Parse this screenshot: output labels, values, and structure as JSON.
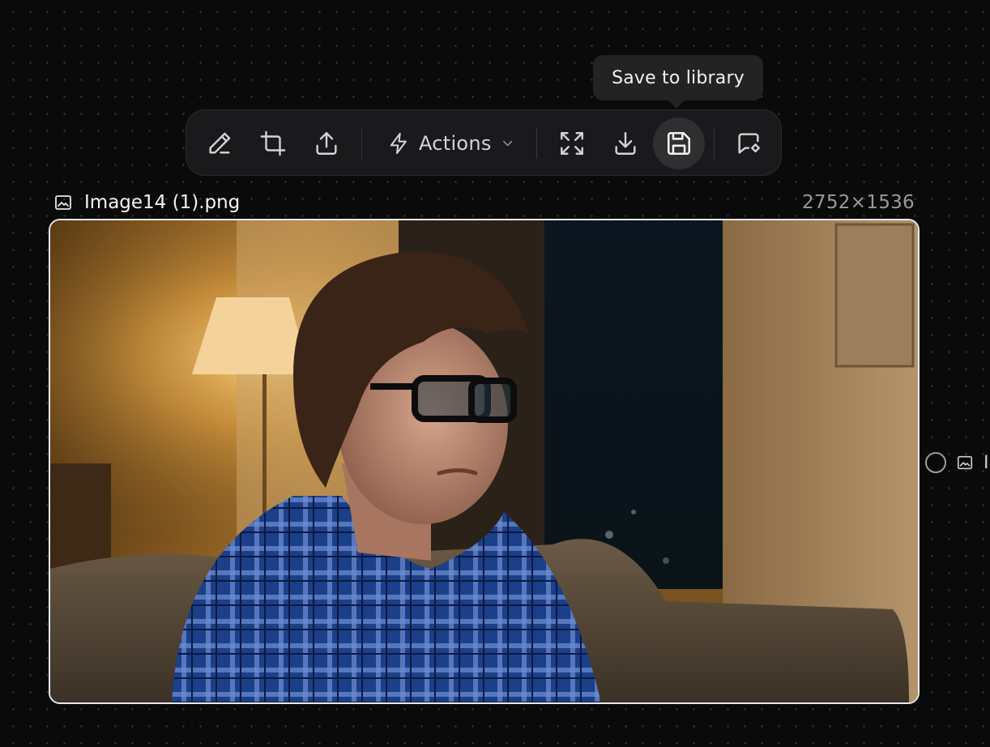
{
  "tooltip": {
    "text": "Save to library"
  },
  "toolbar": {
    "actions_label": "Actions",
    "icons": [
      "pencil-icon",
      "crop-icon",
      "upload-icon",
      "lightning-icon",
      "chevron-down-icon",
      "expand-icon",
      "download-icon",
      "save-icon",
      "annotate-icon"
    ]
  },
  "node": {
    "filename": "Image14 (1).png",
    "dimensions": "2752×1536"
  },
  "side_node": {
    "label": "Ir"
  },
  "colors": {
    "background": "#0a0a0b",
    "toolbar_bg": "#1a1a1c",
    "active_button_bg": "#2f2f32",
    "selection_border": "#e9e9eb"
  }
}
